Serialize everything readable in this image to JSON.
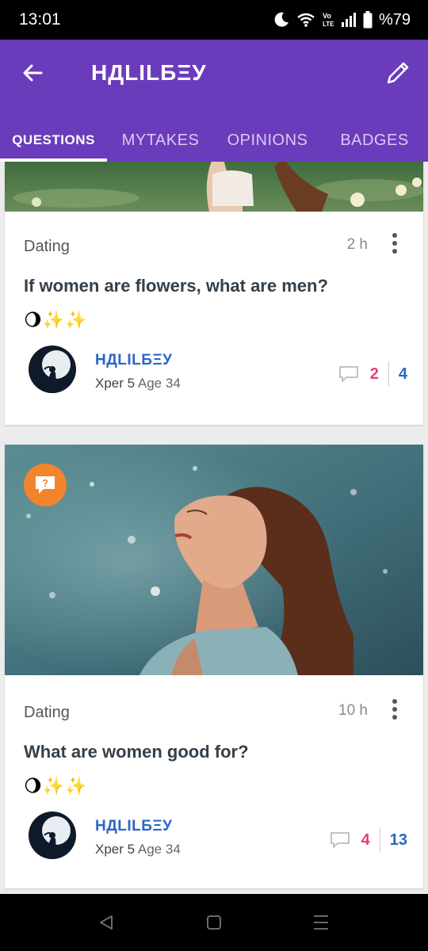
{
  "status_bar": {
    "time": "13:01",
    "battery": "%79"
  },
  "app_bar": {
    "title": "НДLILБΞУ"
  },
  "tabs": [
    {
      "label": "QUESTIONS"
    },
    {
      "label": "MYTAKES"
    },
    {
      "label": "OPINIONS"
    },
    {
      "label": "BADGES"
    }
  ],
  "posts": [
    {
      "category": "Dating",
      "time": "2 h",
      "title": "If women are flowers, what are men?",
      "emoji": "🌖✨✨",
      "author": {
        "name": "НДLILБΞУ",
        "level": "Xper 5",
        "age": "Age 34"
      },
      "comments": "2",
      "opinions": "4"
    },
    {
      "category": "Dating",
      "time": "10 h",
      "title": "What are women good for?",
      "emoji": "🌖✨✨",
      "author": {
        "name": "НДLILБΞУ",
        "level": "Xper 5",
        "age": "Age 34"
      },
      "comments": "4",
      "opinions": "13",
      "badge_icon": "question-badge-icon"
    }
  ],
  "colors": {
    "app_bar": "#6a3cbc",
    "link_blue": "#2a66c5",
    "comment_pink": "#e0427a",
    "badge_orange": "#f2842c"
  }
}
